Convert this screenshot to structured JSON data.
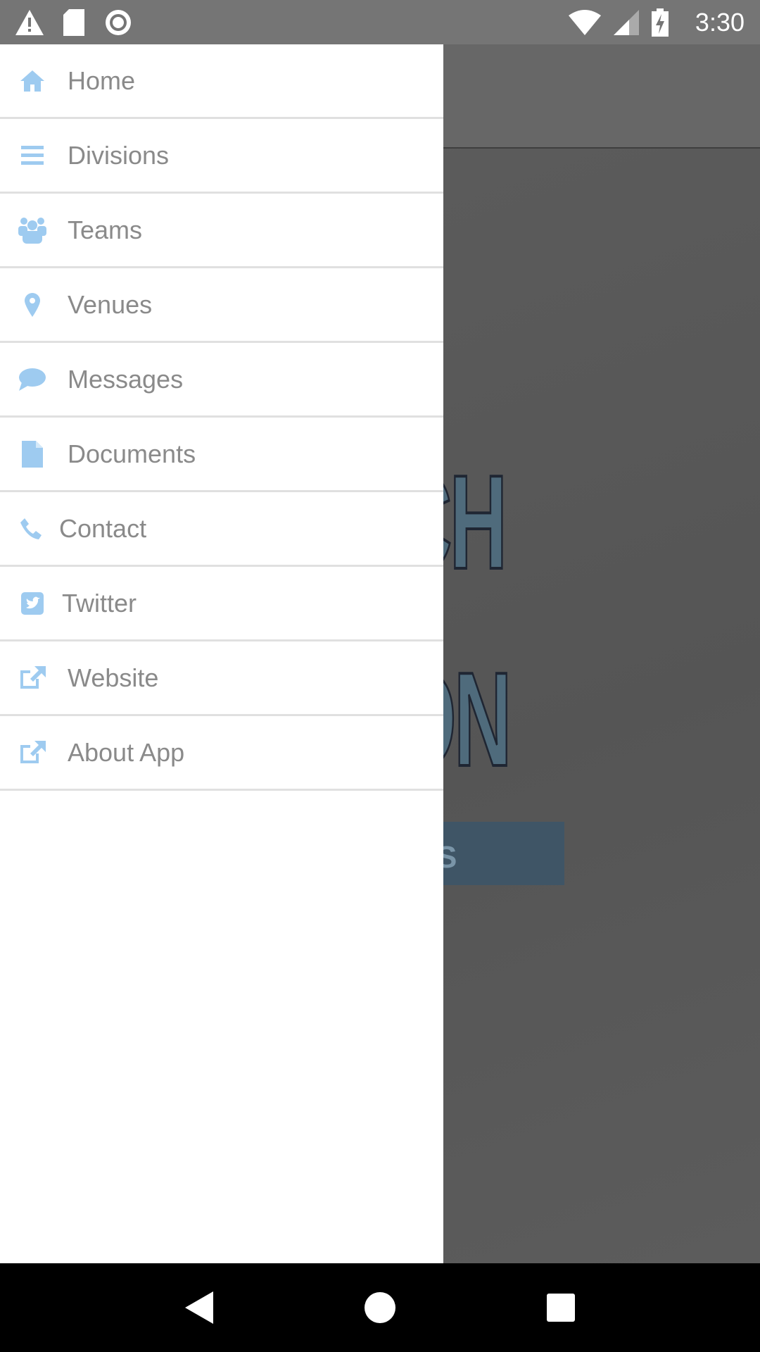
{
  "status_bar": {
    "time": "3:30",
    "icons": [
      "warning-icon",
      "sd-card-icon",
      "record-icon",
      "wifi-icon",
      "signal-icon",
      "battery-charging-icon"
    ]
  },
  "background": {
    "logo_fragment_top": "CH",
    "logo_fragment_bottom": "ON",
    "button_fragment": "S"
  },
  "drawer": {
    "icon_color": "#9ecbf0",
    "text_color": "#8a8a8a",
    "items": [
      {
        "label": "Home",
        "icon": "home-icon"
      },
      {
        "label": "Divisions",
        "icon": "list-icon"
      },
      {
        "label": "Teams",
        "icon": "users-icon"
      },
      {
        "label": "Venues",
        "icon": "map-marker-icon"
      },
      {
        "label": "Messages",
        "icon": "comment-icon"
      },
      {
        "label": "Documents",
        "icon": "file-icon"
      },
      {
        "label": "Contact",
        "icon": "phone-icon"
      },
      {
        "label": "Twitter",
        "icon": "twitter-icon"
      },
      {
        "label": "Website",
        "icon": "external-link-icon"
      },
      {
        "label": "About App",
        "icon": "external-link-icon"
      }
    ]
  },
  "nav_bar": {
    "buttons": [
      "back",
      "home",
      "recents"
    ]
  }
}
